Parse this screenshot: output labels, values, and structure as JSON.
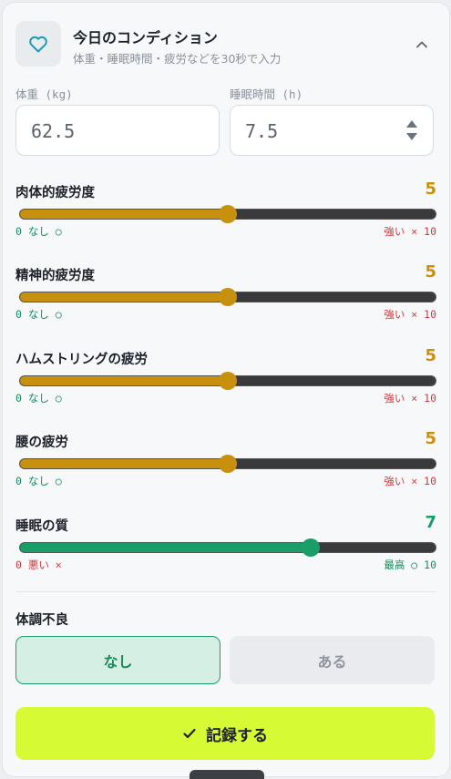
{
  "header": {
    "title": "今日のコンディション",
    "subtitle": "体重・睡眠時間・疲労などを30秒で入力",
    "icon": "heart-icon",
    "collapse_icon": "chevron-up-icon"
  },
  "fields": {
    "weight": {
      "label": "体重 (kg)",
      "value": "62.5"
    },
    "sleep_hours": {
      "label": "睡眠時間 (h)",
      "value": "7.5"
    }
  },
  "sliders": [
    {
      "label": "肉体的疲労度",
      "value": "5",
      "level": 0.5,
      "min_label": "0 なし ○",
      "max_label": "強い × 10",
      "color": "#c8900f",
      "min_color": "#1a8a5c",
      "max_color": "#d0383c"
    },
    {
      "label": "精神的疲労度",
      "value": "5",
      "level": 0.5,
      "min_label": "0 なし ○",
      "max_label": "強い × 10",
      "color": "#c8900f",
      "min_color": "#1a8a5c",
      "max_color": "#d0383c"
    },
    {
      "label": "ハムストリングの疲労",
      "value": "5",
      "level": 0.5,
      "min_label": "0 なし ○",
      "max_label": "強い × 10",
      "color": "#c8900f",
      "min_color": "#1a8a5c",
      "max_color": "#d0383c"
    },
    {
      "label": "腰の疲労",
      "value": "5",
      "level": 0.5,
      "min_label": "0 なし ○",
      "max_label": "強い × 10",
      "color": "#c8900f",
      "min_color": "#1a8a5c",
      "max_color": "#d0383c"
    },
    {
      "label": "睡眠の質",
      "value": "7",
      "level": 0.7,
      "min_label": "0 悪い ×",
      "max_label": "最高 ○ 10",
      "color": "#1a9d67",
      "min_color": "#d0383c",
      "max_color": "#1a8a5c"
    }
  ],
  "illness": {
    "label": "体調不良",
    "option_none": "なし",
    "option_yes": "ある",
    "selected": "なし"
  },
  "record_button": {
    "label": "記録する",
    "icon": "check-icon"
  },
  "colors": {
    "accent": "#d6fa34",
    "selected_green": "#1a8a5c",
    "fatigue": "#c8900f"
  }
}
